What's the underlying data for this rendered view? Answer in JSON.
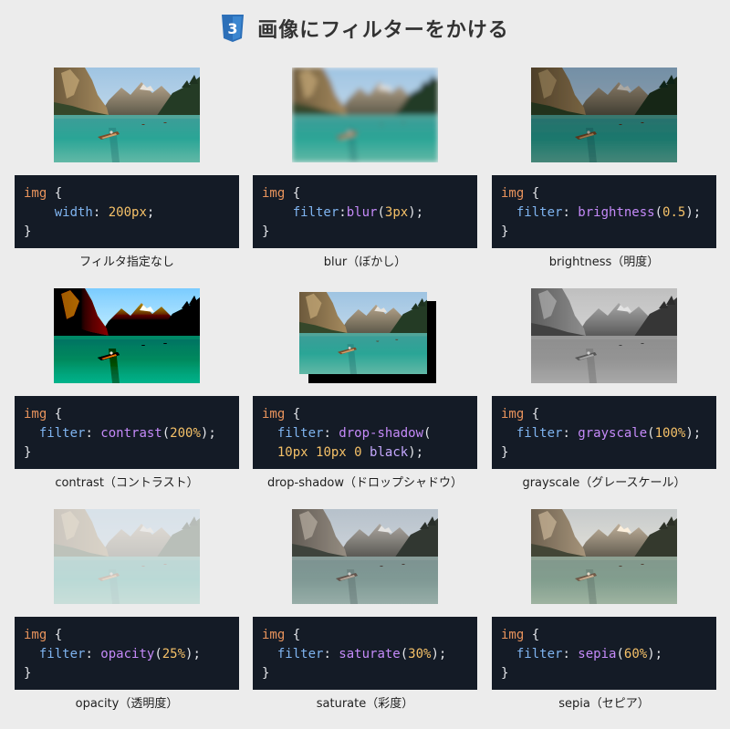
{
  "header": {
    "logo_icon": "css3-icon",
    "logo_text": "3",
    "title": "画像にフィルターをかける"
  },
  "colors": {
    "page_background": "#ececec",
    "code_background": "#141b26",
    "selector": "#e8935c",
    "property": "#7fb4f0",
    "function": "#c58af9",
    "number": "#f5c168",
    "css3_blue": "#2c6fb8"
  },
  "cards": [
    {
      "name": "none",
      "image_icon": "lake-photo",
      "code": [
        {
          "sel": "img",
          "brace": "{"
        },
        {
          "prop": "width",
          "value": "200px",
          "end": ";"
        },
        {
          "close": "}"
        }
      ],
      "caption": "フィルタ指定なし"
    },
    {
      "name": "blur",
      "image_icon": "lake-photo",
      "code": [
        {
          "sel": "img",
          "brace": "{"
        },
        {
          "prop": "filter",
          "fn": "blur",
          "arg": "3px",
          "end": ");"
        },
        {
          "close": "}"
        }
      ],
      "caption": "blur（ぼかし）"
    },
    {
      "name": "brightness",
      "image_icon": "lake-photo",
      "code": [
        {
          "sel": "img",
          "brace": "{"
        },
        {
          "prop": "filter",
          "fn": "brightness",
          "arg": "0.5",
          "end": ");"
        },
        {
          "close": "}"
        }
      ],
      "caption": "brightness（明度）"
    },
    {
      "name": "contrast",
      "image_icon": "lake-photo",
      "code": [
        {
          "sel": "img",
          "brace": "{"
        },
        {
          "prop": "filter",
          "fn": "contrast",
          "arg": "200%",
          "end": ");"
        },
        {
          "close": "}"
        }
      ],
      "caption": "contrast（コントラスト）"
    },
    {
      "name": "drop-shadow",
      "image_icon": "lake-photo",
      "code": [
        {
          "sel": "img",
          "brace": "{"
        },
        {
          "prop": "filter",
          "fn": "drop-shadow",
          "open": "("
        },
        {
          "a": "10px",
          "b": "10px",
          "c": "0",
          "d": "black",
          "end": ");"
        }
      ],
      "caption": "drop-shadow（ドロップシャドウ）"
    },
    {
      "name": "grayscale",
      "image_icon": "lake-photo",
      "code": [
        {
          "sel": "img",
          "brace": "{"
        },
        {
          "prop": "filter",
          "fn": "grayscale",
          "arg": "100%",
          "end": ");"
        },
        {
          "close": "}"
        }
      ],
      "caption": "grayscale（グレースケール）"
    },
    {
      "name": "opacity",
      "image_icon": "lake-photo",
      "code": [
        {
          "sel": "img",
          "brace": "{"
        },
        {
          "prop": "filter",
          "fn": "opacity",
          "arg": "25%",
          "end": ");"
        },
        {
          "close": "}"
        }
      ],
      "caption": "opacity（透明度）"
    },
    {
      "name": "saturate",
      "image_icon": "lake-photo",
      "code": [
        {
          "sel": "img",
          "brace": "{"
        },
        {
          "prop": "filter",
          "fn": "saturate",
          "arg": "30%",
          "end": ");"
        },
        {
          "close": "}"
        }
      ],
      "caption": "saturate（彩度）"
    },
    {
      "name": "sepia",
      "image_icon": "lake-photo",
      "code": [
        {
          "sel": "img",
          "brace": "{"
        },
        {
          "prop": "filter",
          "fn": "sepia",
          "arg": "60%",
          "end": ");"
        },
        {
          "close": "}"
        }
      ],
      "caption": "sepia（セピア）"
    }
  ]
}
